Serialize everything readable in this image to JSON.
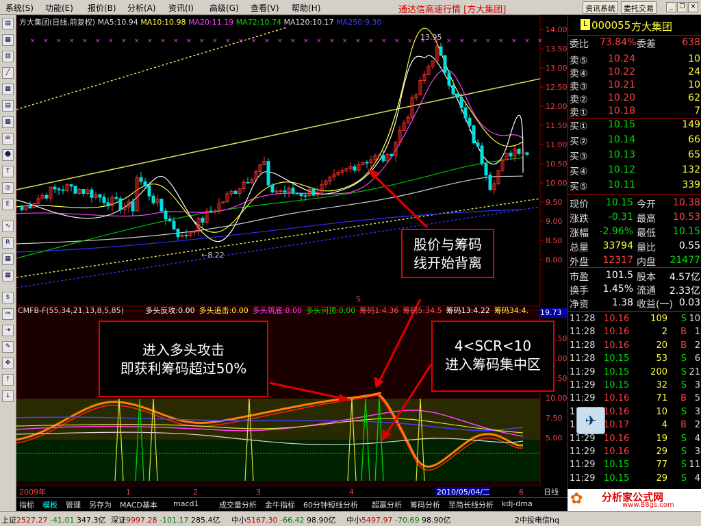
{
  "menu": {
    "items": [
      "系统(S)",
      "功能(E)",
      "报价(B)",
      "分析(A)",
      "资讯(I)",
      "高级(G)",
      "查看(V)",
      "帮助(H)"
    ],
    "app_title": "通达信高速行情",
    "stock_tag": "[方大集团]",
    "btn_info": "资讯系统",
    "btn_trade": "委托交易"
  },
  "chart": {
    "header_name": "方大集团(日线,前复权)",
    "ma5": "MA5:10.94",
    "ma10": "MA10:10.98",
    "ma20": "MA20:11.19",
    "ma72": "MA72:10.74",
    "ma120": "MA120:10.17",
    "ma250": "MA250:9.30",
    "high_label": "13.95",
    "low_label": "←8.22",
    "s_mark": "S",
    "y_labels": [
      "14.00",
      "13.50",
      "13.00",
      "12.50",
      "12.00",
      "11.50",
      "11.00",
      "10.50",
      "10.00",
      "9.50",
      "9.00",
      "8.50",
      "8.00"
    ],
    "indicator_header": {
      "name": "CMFB-F(55,34,21,13,8,5,85)",
      "items": [
        {
          "text": "多头反攻:0.00",
          "color": "#ffffff"
        },
        {
          "text": "多头追击:0.00",
          "color": "#ffff40"
        },
        {
          "text": "多头筑底:0.00",
          "color": "#ff40ff"
        },
        {
          "text": "多头问顶:0.00",
          "color": "#00e000"
        },
        {
          "text": "筹码1:4.36",
          "color": "#ff6060"
        },
        {
          "text": "筹码5:34.5",
          "color": "#ff6060"
        },
        {
          "text": "筹码13:4.22",
          "color": "#ffffff"
        },
        {
          "text": "筹码34:4.",
          "color": "#ffff40"
        }
      ]
    },
    "indicator_value": "19.73",
    "ind_y_labels": [
      "17.50",
      "15.00",
      "12.50",
      "10.00",
      "7.50",
      "5.00"
    ],
    "x_labels": [
      "2009年",
      "1",
      "2",
      "3",
      "4",
      "5",
      "6"
    ],
    "cursor_date": "2010/05/04/二",
    "period": "日线"
  },
  "annotations": {
    "a1_line1": "股价与筹码",
    "a1_line2": "线开始背离",
    "a2_line1": "进入多头攻击",
    "a2_line2": "即获利筹码超过50%",
    "a3_line1": "4<SCR<10",
    "a3_line2": "进入筹码集中区"
  },
  "quote": {
    "code": "000055",
    "name": "方大集团",
    "weibi_label": "委比",
    "weibi": "73.84%",
    "weicha_label": "委差",
    "weicha": "638",
    "asks": [
      {
        "label": "卖⑤",
        "price": "10.24",
        "vol": "10"
      },
      {
        "label": "卖④",
        "price": "10.22",
        "vol": "24"
      },
      {
        "label": "卖③",
        "price": "10.21",
        "vol": "10"
      },
      {
        "label": "卖②",
        "price": "10.20",
        "vol": "62"
      },
      {
        "label": "卖①",
        "price": "10.18",
        "vol": "7"
      }
    ],
    "bids": [
      {
        "label": "买①",
        "price": "10.15",
        "vol": "149"
      },
      {
        "label": "买②",
        "price": "10.14",
        "vol": "66"
      },
      {
        "label": "买③",
        "price": "10.13",
        "vol": "65"
      },
      {
        "label": "买④",
        "price": "10.12",
        "vol": "132"
      },
      {
        "label": "买⑤",
        "price": "10.11",
        "vol": "339"
      }
    ],
    "stats": [
      {
        "l1": "现价",
        "v1": "10.15",
        "c1": "#00e000",
        "l2": "今开",
        "v2": "10.38",
        "c2": "#ff4040"
      },
      {
        "l1": "涨跌",
        "v1": "-0.31",
        "c1": "#00e000",
        "l2": "最高",
        "v2": "10.53",
        "c2": "#ff4040"
      },
      {
        "l1": "涨幅",
        "v1": "-2.96%",
        "c1": "#00e000",
        "l2": "最低",
        "v2": "10.15",
        "c2": "#00e000"
      },
      {
        "l1": "总量",
        "v1": "33794",
        "c1": "#ffff40",
        "l2": "量比",
        "v2": "0.55",
        "c2": "#ffffff"
      },
      {
        "l1": "外盘",
        "v1": "12317",
        "c1": "#ff4040",
        "l2": "内盘",
        "v2": "21477",
        "c2": "#00e000"
      }
    ],
    "fundamentals": [
      {
        "l1": "市盈",
        "v1": "101.5",
        "l2": "股本",
        "v2": "4.57亿"
      },
      {
        "l1": "换手",
        "v1": "1.45%",
        "l2": "流通",
        "v2": "2.33亿"
      },
      {
        "l1": "净资",
        "v1": "1.38",
        "l2": "收益(一)",
        "v2": "0.03"
      }
    ],
    "ticks": [
      {
        "time": "11:28",
        "price": "10.16",
        "vol": "109",
        "bs": "S",
        "n": "10"
      },
      {
        "time": "11:28",
        "price": "10.16",
        "vol": "2",
        "bs": "B",
        "n": "1"
      },
      {
        "time": "11:28",
        "price": "10.16",
        "vol": "20",
        "bs": "B",
        "n": "2"
      },
      {
        "time": "11:28",
        "price": "10.15",
        "vol": "53",
        "bs": "S",
        "n": "6"
      },
      {
        "time": "11:29",
        "price": "10.15",
        "vol": "200",
        "bs": "S",
        "n": "21"
      },
      {
        "time": "11:29",
        "price": "10.15",
        "vol": "32",
        "bs": "S",
        "n": "3"
      },
      {
        "time": "11:29",
        "price": "10.16",
        "vol": "71",
        "bs": "B",
        "n": "5"
      },
      {
        "time": "11:29",
        "price": "10.16",
        "vol": "10",
        "bs": "S",
        "n": "3"
      },
      {
        "time": "11:29",
        "price": "10.17",
        "vol": "4",
        "bs": "B",
        "n": "2"
      },
      {
        "time": "11:29",
        "price": "10.16",
        "vol": "19",
        "bs": "S",
        "n": "4"
      },
      {
        "time": "11:29",
        "price": "10.16",
        "vol": "29",
        "bs": "S",
        "n": "3"
      },
      {
        "time": "11:29",
        "price": "10.15",
        "vol": "77",
        "bs": "S",
        "n": "11"
      },
      {
        "time": "11:29",
        "price": "10.15",
        "vol": "29",
        "bs": "S",
        "n": "4"
      }
    ]
  },
  "bottom_tabs": [
    "指标",
    "模板",
    "管理",
    "另存为",
    "MACD基本",
    "macd1",
    "成交量分析",
    "金牛指标",
    "60分钟短线分析",
    "超赢分析",
    "筹码分析",
    "至简长线分析",
    "kdj-dma"
  ],
  "status": {
    "sh_label": "上证",
    "sh_val": "2527.27",
    "sh_chg": "-41.01",
    "sh_amt": "347.3亿",
    "sz_label": "深证",
    "sz_val": "9997.28",
    "sz_chg": "-101.17",
    "sz_amt": "285.4亿",
    "zx_label": "中小",
    "zx_val": "5167.30",
    "zx_chg": "-66.42",
    "zx_amt": "98.90亿",
    "zx2_label": "中小",
    "zx2_val": "5497.97",
    "zx2_chg": "-70.69",
    "zx2_amt": "98.90亿",
    "server": "2中投电信hq"
  },
  "logo": {
    "text": "分析家公式网",
    "url": "www.88gs.com"
  }
}
